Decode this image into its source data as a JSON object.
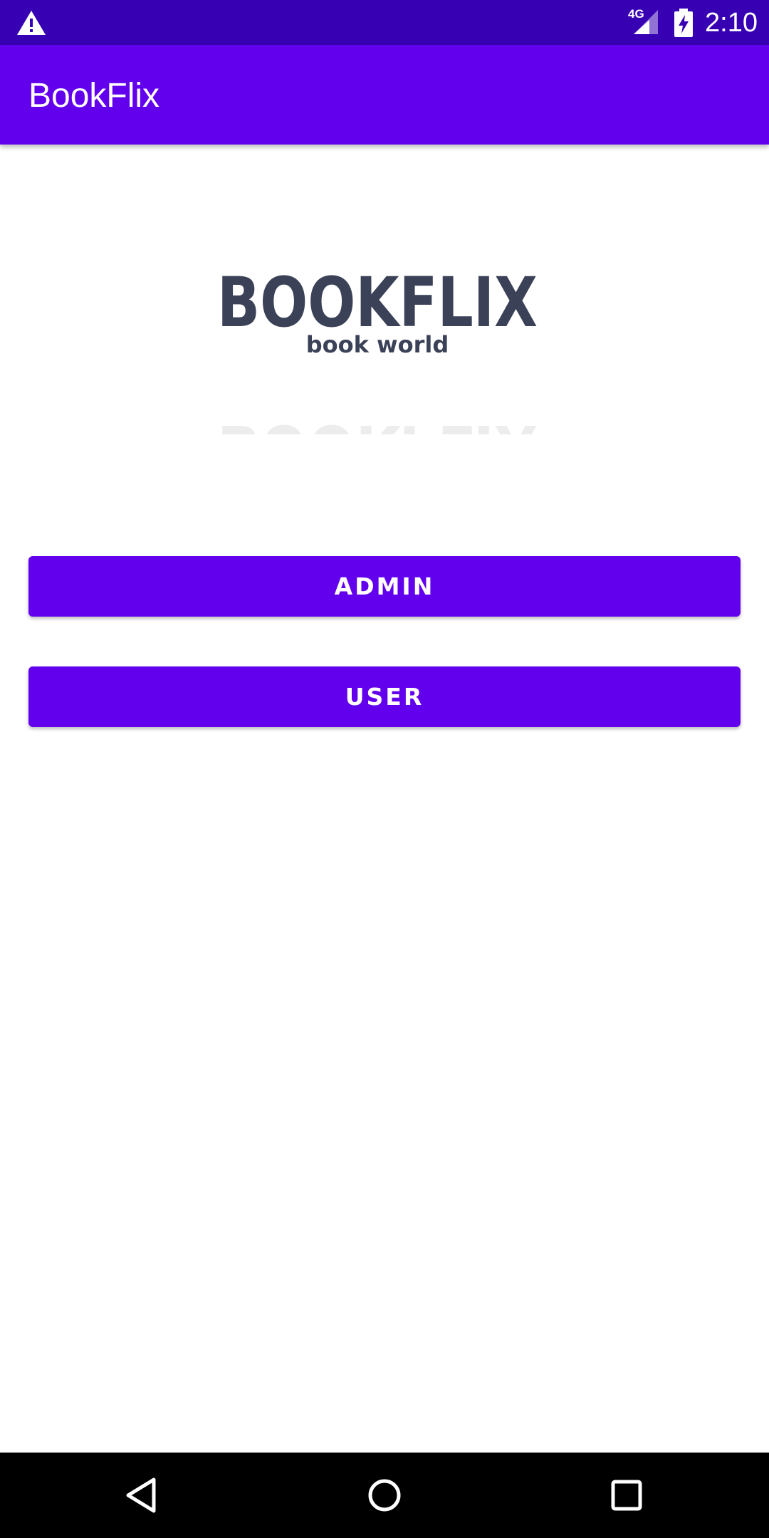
{
  "status_bar": {
    "network_type": "4G",
    "time": "2:10",
    "icons": [
      "warning-icon",
      "signal-icon",
      "battery-charging-icon"
    ]
  },
  "app_bar": {
    "title": "BookFlix"
  },
  "logo": {
    "wordmark": "BOOKFLIX",
    "tagline": "book world",
    "colors": {
      "wordmark": "#3b4157",
      "reflection": "#e6e6e6"
    }
  },
  "buttons": {
    "admin_label": "ADMIN",
    "user_label": "USER"
  },
  "nav_bar": {
    "icons": [
      "back-icon",
      "home-icon",
      "recents-icon"
    ]
  },
  "colors": {
    "status_bar": "#3700b3",
    "primary": "#6200ee",
    "on_primary": "#ffffff",
    "nav_bar": "#000000"
  }
}
